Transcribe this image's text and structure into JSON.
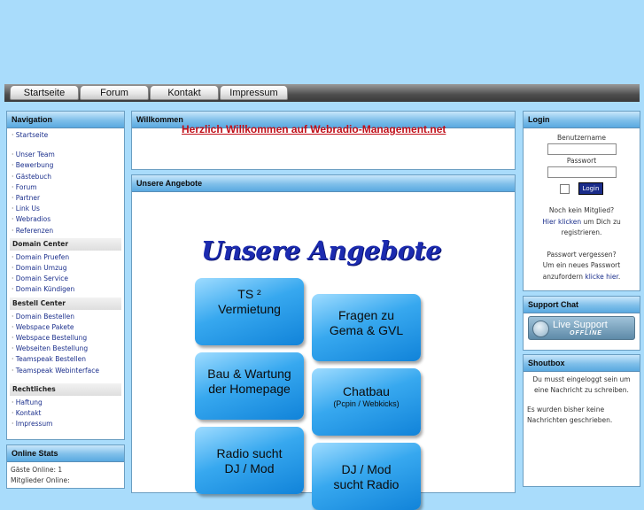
{
  "topnav": [
    "Startseite",
    "Forum",
    "Kontakt",
    "Impressum"
  ],
  "navigation": {
    "title": "Navigation",
    "items": [
      "Startseite"
    ],
    "items2": [
      "Unser Team",
      "Bewerbung",
      "Gästebuch",
      "Forum",
      "Partner",
      "Link Us",
      "Webradios",
      "Referenzen"
    ],
    "domain_title": "Domain Center",
    "domain_items": [
      "Domain Pruefen",
      "Domain Umzug",
      "Domain Service",
      "Domain Kündigen"
    ],
    "bestell_title": "Bestell Center",
    "bestell_items": [
      "Domain Bestellen",
      "Webspace Pakete",
      "Webspace Bestellung",
      "Webseiten Bestellung",
      "Teamspeak Bestellen",
      "Teamspeak Webinterface"
    ],
    "recht_title": "Rechtliches",
    "recht_items": [
      "Haftung",
      "Kontakt",
      "Impressum"
    ]
  },
  "online_stats": {
    "title": "Online Stats",
    "line1": "Gäste Online: 1",
    "line2": "Mitglieder Online:"
  },
  "welcome": {
    "title": "Willkommen",
    "link": "Herzlich Willkommen auf Webradio-Management.net"
  },
  "angebote": {
    "title": "Unsere Angebote",
    "banner": "Unsere Angebote",
    "buttons": [
      {
        "l1": "TS ²",
        "l2": "Vermietung"
      },
      {
        "l1": "Fragen zu",
        "l2": "Gema & GVL"
      },
      {
        "l1": "Bau & Wartung",
        "l2": "der Homepage"
      },
      {
        "l1": "Chatbau",
        "l2": "(Pcpin / Webkicks)"
      },
      {
        "l1": "Radio sucht",
        "l2": "DJ / Mod"
      },
      {
        "l1": "DJ / Mod",
        "l2": "sucht Radio"
      }
    ]
  },
  "login": {
    "title": "Login",
    "user_label": "Benutzername",
    "pass_label": "Passwort",
    "button": "Login",
    "no_member": "Noch kein Mitglied?",
    "click_here": "Hier klicken",
    "register_rest": " um Dich zu",
    "register_end": "registrieren.",
    "forgot": "Passwort vergessen?",
    "new_pass": "Um ein neues Passwort",
    "request": "anzufordern ",
    "click_link": "klicke hier",
    "dot": "."
  },
  "support": {
    "title": "Support Chat",
    "live": "Live Support",
    "status": "OFFLINE"
  },
  "shoutbox": {
    "title": "Shoutbox",
    "msg1": "Du musst eingeloggt sein um eine Nachricht zu schreiben.",
    "msg2": "Es wurden bisher keine Nachrichten geschrieben."
  }
}
